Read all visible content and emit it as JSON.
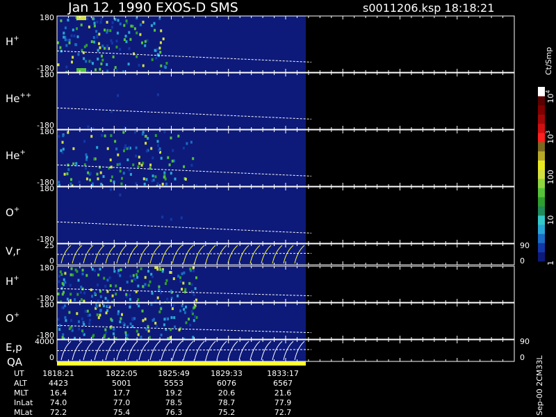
{
  "header": {
    "title": "Jan 12, 1990    EXOS-D SMS",
    "file": "s0011206.ksp  18:18:21"
  },
  "chart_data": {
    "type": "heatmap",
    "title": "Jan 12, 1990    EXOS-D SMS",
    "panels": [
      {
        "label": "H",
        "sup": "+",
        "ymax": "180",
        "ymin": "-180",
        "right_ticks": []
      },
      {
        "label": "He",
        "sup": "++",
        "ymax": "180",
        "ymin": "-180",
        "right_ticks": []
      },
      {
        "label": "He",
        "sup": "+",
        "ymax": "180",
        "ymin": "-180",
        "right_ticks": []
      },
      {
        "label": "O",
        "sup": "+",
        "ymax": "180",
        "ymin": "-180",
        "right_ticks": []
      },
      {
        "label": "V,r",
        "sup": "",
        "ymax": "25",
        "ymin": "0",
        "right_ticks": [
          "90",
          "0"
        ]
      },
      {
        "label": "H",
        "sup": "+",
        "ymax": "180",
        "ymin": "-180",
        "right_ticks": []
      },
      {
        "label": "O",
        "sup": "+",
        "ymax": "180",
        "ymin": "-180",
        "right_ticks": []
      },
      {
        "label": "E,p",
        "sup": "",
        "ymax": "4000",
        "ymin": "0",
        "right_ticks": [
          "90",
          "0"
        ]
      }
    ],
    "qa_label": "QA",
    "colorbar": {
      "unit": "Ct/Smp",
      "ticks": [
        {
          "label": "1",
          "sup": "",
          "value": 1
        },
        {
          "label": "10",
          "sup": "",
          "value": 10
        },
        {
          "label": "100",
          "sup": "",
          "value": 100
        },
        {
          "label": "10",
          "sup": "3",
          "value": 1000
        },
        {
          "label": "10",
          "sup": "4",
          "value": 10000
        }
      ],
      "colors": [
        "#0d1a7a",
        "#1238a8",
        "#1a6cc4",
        "#29a6d6",
        "#34c9c9",
        "#1f8a5a",
        "#2e9e2e",
        "#55c23a",
        "#8fd640",
        "#d4e040",
        "#e8e820",
        "#b8a828",
        "#7a6a20",
        "#ff2020",
        "#d01010",
        "#a00808",
        "#800000",
        "#5a0000",
        "#ffffff"
      ]
    },
    "ephemeris": {
      "rows": [
        "UT",
        "ALT",
        "MLT",
        "InLat",
        "MLat"
      ],
      "columns": [
        {
          "UT": "1818:21",
          "ALT": "4423",
          "MLT": "16.4",
          "InLat": "74.0",
          "MLat": "72.2"
        },
        {
          "UT": "1822:05",
          "ALT": "5001",
          "MLT": "17.7",
          "InLat": "77.0",
          "MLat": "75.4"
        },
        {
          "UT": "1825:49",
          "ALT": "5553",
          "MLT": "19.2",
          "InLat": "78.5",
          "MLat": "76.3"
        },
        {
          "UT": "1829:33",
          "ALT": "6076",
          "MLT": "20.6",
          "InLat": "78.7",
          "MLat": "75.2"
        },
        {
          "UT": "1833:17",
          "ALT": "6567",
          "MLT": "21.6",
          "InLat": "77.9",
          "MLat": "72.7"
        }
      ]
    },
    "side_label": "Sep-00  2CM33L",
    "colors": {
      "background": "#000000",
      "fill": "#0d1a7a",
      "trace": "#ffffff",
      "yellow": "#ffff33",
      "axes": "#ffffff"
    }
  }
}
